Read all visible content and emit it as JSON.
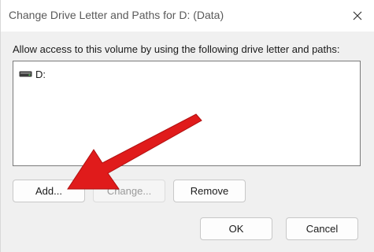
{
  "window": {
    "title": "Change Drive Letter and Paths for D: (Data)",
    "close_icon": "close-icon"
  },
  "prompt": "Allow access to this volume by using the following drive letter and paths:",
  "list": {
    "items": [
      {
        "icon": "drive-icon",
        "label": "D:"
      }
    ]
  },
  "buttons": {
    "add": "Add...",
    "change": "Change...",
    "remove": "Remove",
    "ok": "OK",
    "cancel": "Cancel"
  },
  "annotation": {
    "icon": "red-arrow-icon",
    "color": "#e01b1b"
  }
}
